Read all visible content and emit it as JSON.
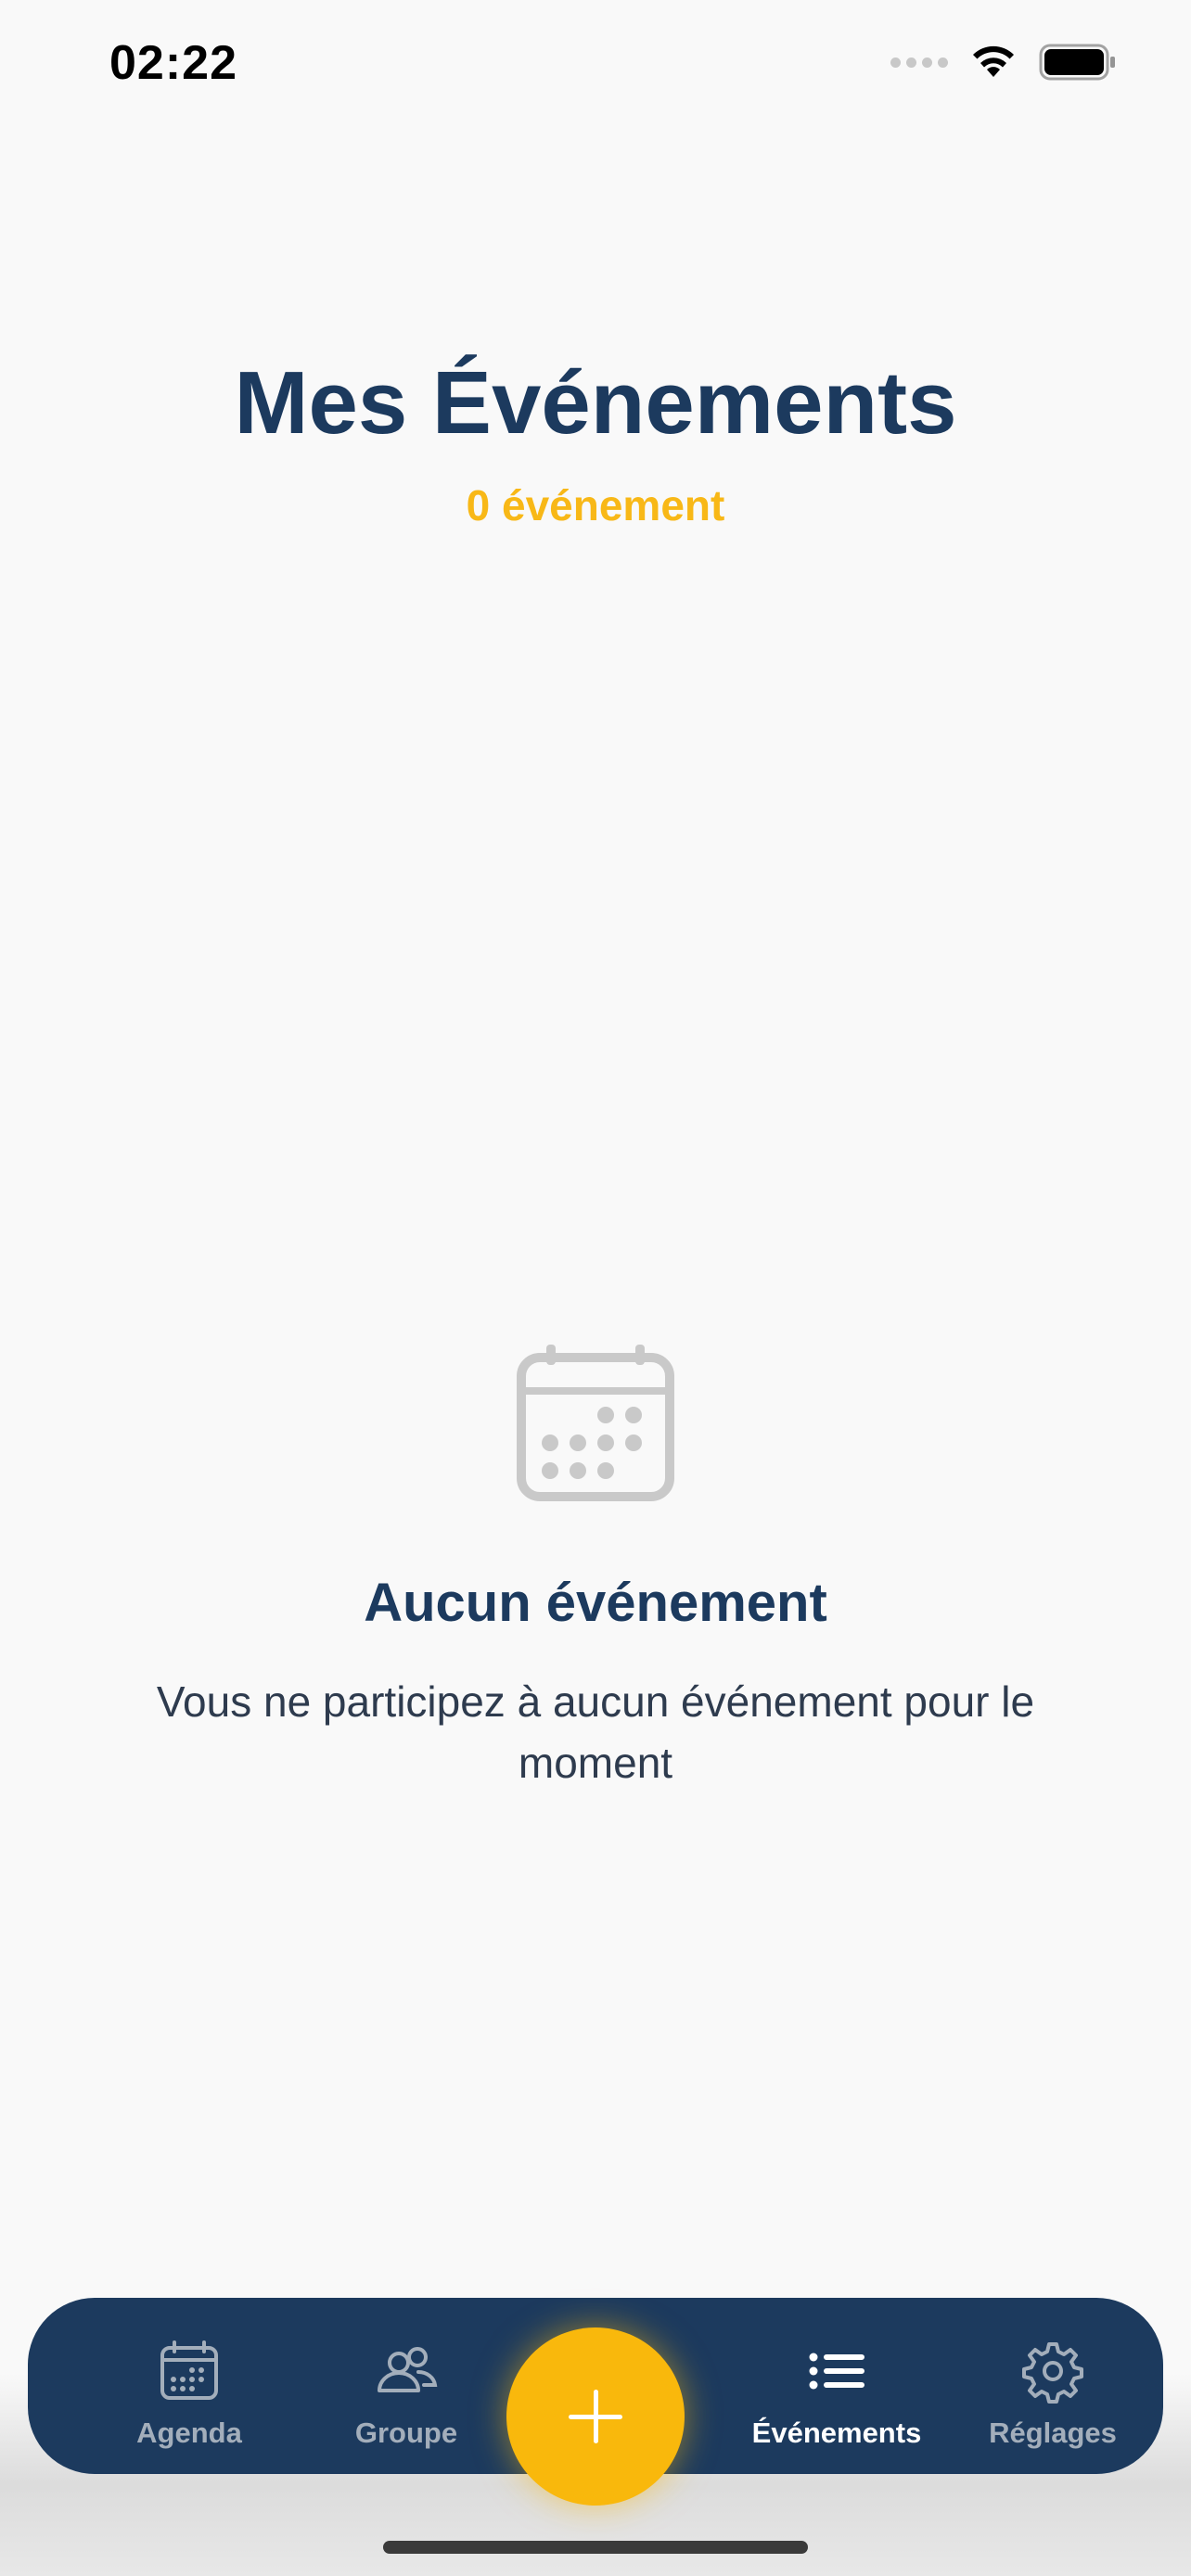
{
  "status_bar": {
    "time": "02:22"
  },
  "header": {
    "title": "Mes Événements",
    "count": "0 événement"
  },
  "empty_state": {
    "icon": "calendar-icon",
    "title": "Aucun événement",
    "message": "Vous ne participez à aucun événement pour le moment"
  },
  "tab_bar": {
    "tabs": [
      {
        "label": "Agenda",
        "icon": "calendar-icon",
        "active": false
      },
      {
        "label": "Groupe",
        "icon": "people-icon",
        "active": false
      },
      {
        "label": "Événements",
        "icon": "list-icon",
        "active": true
      },
      {
        "label": "Réglages",
        "icon": "gear-icon",
        "active": false
      }
    ],
    "add_button_icon": "plus-icon"
  },
  "colors": {
    "primary": "#1c3a5e",
    "accent": "#f9b80c",
    "background": "#f9f9f9",
    "inactive_tab": "#a3aebb"
  }
}
